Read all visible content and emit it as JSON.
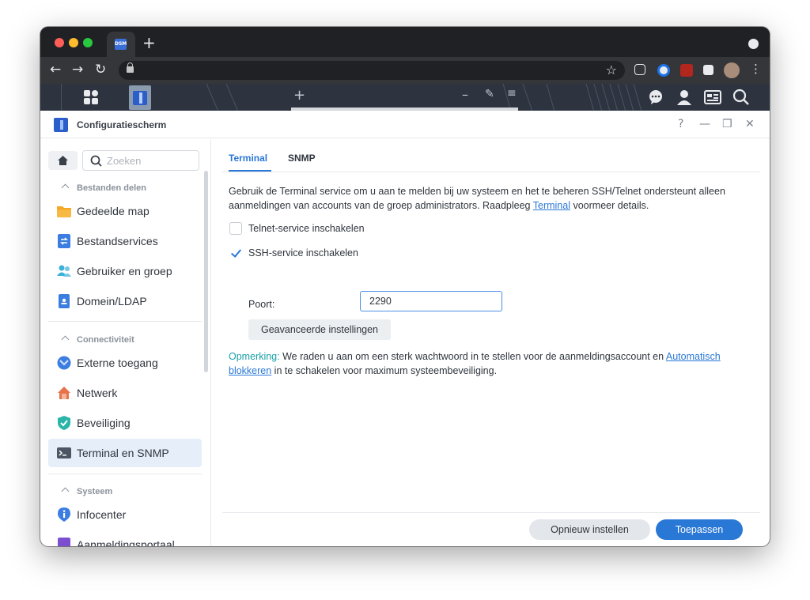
{
  "browser": {
    "tab_title": "",
    "favicon_text": "DSM",
    "new_tab_icon": "plus-icon",
    "url": "",
    "nav_icons": [
      "back-icon",
      "forward-icon",
      "reload-icon"
    ],
    "extension_icons": [
      "pocket-icon",
      "onepassword-icon",
      "ublock-icon",
      "puzzle-icon",
      "profile-avatar-icon",
      "kebab-menu-icon"
    ]
  },
  "dsm_taskbar": {
    "icons": [
      "main-menu-icon",
      "control-panel-icon",
      "add-widget-icon",
      "minimize-icon",
      "pin-icon",
      "notification-icon",
      "chat-icon",
      "user-icon",
      "widgets-icon",
      "search-icon"
    ]
  },
  "window": {
    "title": "Configuratiescherm",
    "help": "?",
    "minimize": "—",
    "restore": "❐",
    "close": "✕"
  },
  "sidebar": {
    "search_placeholder": "Zoeken",
    "sections": [
      {
        "title": "Bestanden delen",
        "items": [
          {
            "label": "Gedeelde map",
            "icon": "shared-folder-icon"
          },
          {
            "label": "Bestandservices",
            "icon": "file-services-icon"
          },
          {
            "label": "Gebruiker en groep",
            "icon": "user-group-icon"
          },
          {
            "label": "Domein/LDAP",
            "icon": "domain-ldap-icon"
          }
        ]
      },
      {
        "title": "Connectiviteit",
        "items": [
          {
            "label": "Externe toegang",
            "icon": "external-access-icon"
          },
          {
            "label": "Netwerk",
            "icon": "network-icon"
          },
          {
            "label": "Beveiliging",
            "icon": "security-icon"
          },
          {
            "label": "Terminal en SNMP",
            "icon": "terminal-icon",
            "active": true
          }
        ]
      },
      {
        "title": "Systeem",
        "items": [
          {
            "label": "Infocenter",
            "icon": "info-center-icon"
          },
          {
            "label": "Aanmeldingsportaal",
            "icon": "login-portal-icon"
          }
        ]
      }
    ]
  },
  "main": {
    "tabs": [
      {
        "label": "Terminal",
        "active": true
      },
      {
        "label": "SNMP",
        "active": false
      }
    ],
    "description_part1": "Gebruik de Terminal service om u aan te melden bij uw systeem en het te beheren SSH/Telnet ondersteunt alleen aanmeldingen van accounts van de groep administrators. Raadpleeg ",
    "description_link": "Terminal",
    "description_part2": " voormeer details.",
    "telnet_label": "Telnet-service inschakelen",
    "telnet_checked": false,
    "ssh_label": "SSH-service inschakelen",
    "ssh_checked": true,
    "port_label": "Poort:",
    "port_value": "2290",
    "advanced_button": "Geavanceerde instellingen",
    "note_label": "Opmerking:",
    "note_part1": " We raden u aan om een sterk wachtwoord in te stellen voor de aanmeldingsaccount en ",
    "note_link": "Automatisch blokkeren",
    "note_part2": " in te schakelen voor maximum systeembeveiliging."
  },
  "footer": {
    "reset_button": "Opnieuw instellen",
    "apply_button": "Toepassen"
  },
  "colors": {
    "accent": "#2a78d6",
    "note_label": "#1aa0a8",
    "active_item_bg": "#e6eefa"
  }
}
